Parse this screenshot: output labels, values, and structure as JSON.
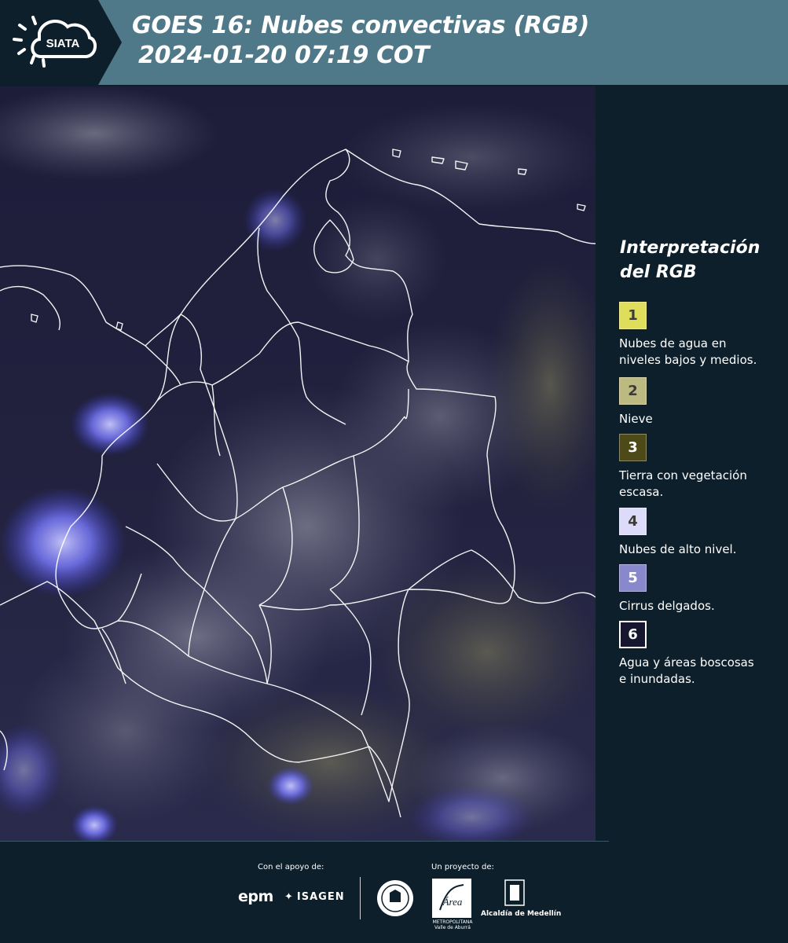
{
  "header": {
    "logo_text": "SIATA",
    "title_line1": "GOES 16: Nubes convectivas (RGB)",
    "title_line2": "2024-01-20 07:19 COT"
  },
  "map": {
    "image_label": "satellite-rgb-composite"
  },
  "legend": {
    "title_line1": "Interpretación",
    "title_line2": "del RGB",
    "items": [
      {
        "number": "1",
        "label": "Nubes de agua en\nniveles bajos y medios.",
        "color": "#dede5a"
      },
      {
        "number": "2",
        "label": "Nieve",
        "color": "#bcba80"
      },
      {
        "number": "3",
        "label": "Tierra con vegetación\nescasa.",
        "color": "#4e4a18"
      },
      {
        "number": "4",
        "label": "Nubes de alto nivel.",
        "color": "#dcdcfa"
      },
      {
        "number": "5",
        "label": "Cirrus delgados.",
        "color": "#8a88cc"
      },
      {
        "number": "6",
        "label": "Agua y áreas boscosas\ne inundadas.",
        "color": "#16162e"
      }
    ]
  },
  "footer": {
    "support_label": "Con el apoyo de:",
    "project_label": "Un proyecto de:",
    "sponsors": [
      "epm",
      "ISAGEN"
    ],
    "amva_lines": [
      "Área",
      "METROPOLITANA",
      "Valle de Aburrá"
    ],
    "alcaldia": "Alcaldía de Medellín"
  }
}
